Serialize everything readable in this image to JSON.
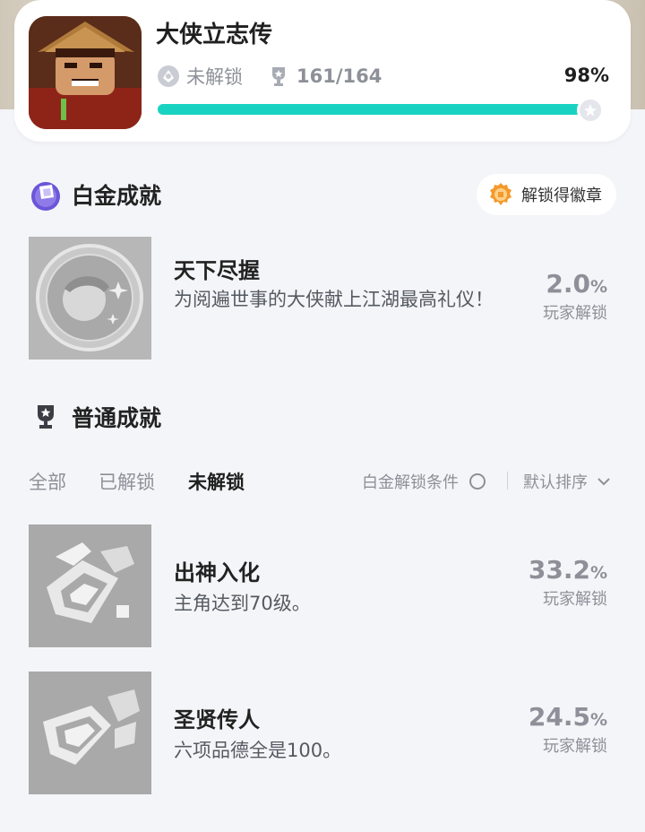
{
  "game": {
    "title": "大侠立志传",
    "status": "未解锁",
    "trophy_progress": "161/164",
    "percent": "98%",
    "progress_fraction": 0.98
  },
  "platinum_section": {
    "title": "白金成就",
    "badge_button": "解锁得徽章",
    "achievement": {
      "name": "天下尽握",
      "desc": "为阅遍世事的大侠献上江湖最高礼仪！",
      "rate": "2.0",
      "rate_unit": "%",
      "rate_label": "玩家解锁"
    }
  },
  "normal_section": {
    "title": "普通成就",
    "tabs": [
      "全部",
      "已解锁",
      "未解锁"
    ],
    "active_tab": "未解锁",
    "filter_label": "白金解锁条件",
    "sort_label": "默认排序",
    "achievements": [
      {
        "name": "出神入化",
        "desc": "主角达到70级。",
        "rate": "33.2",
        "rate_unit": "%",
        "rate_label": "玩家解锁"
      },
      {
        "name": "圣贤传人",
        "desc": "六项品德全是100。",
        "rate": "24.5",
        "rate_unit": "%",
        "rate_label": "玩家解锁"
      }
    ]
  },
  "colors": {
    "accent": "#19d3c2",
    "muted": "#8d9098",
    "badge_orange": "#f39a2b",
    "platinum_purple": "#6b56d9"
  },
  "icons": [
    "lock-status-icon",
    "trophy-icon",
    "platinum-icon",
    "badge-icon",
    "chevron-down-icon",
    "info-circle-icon"
  ]
}
